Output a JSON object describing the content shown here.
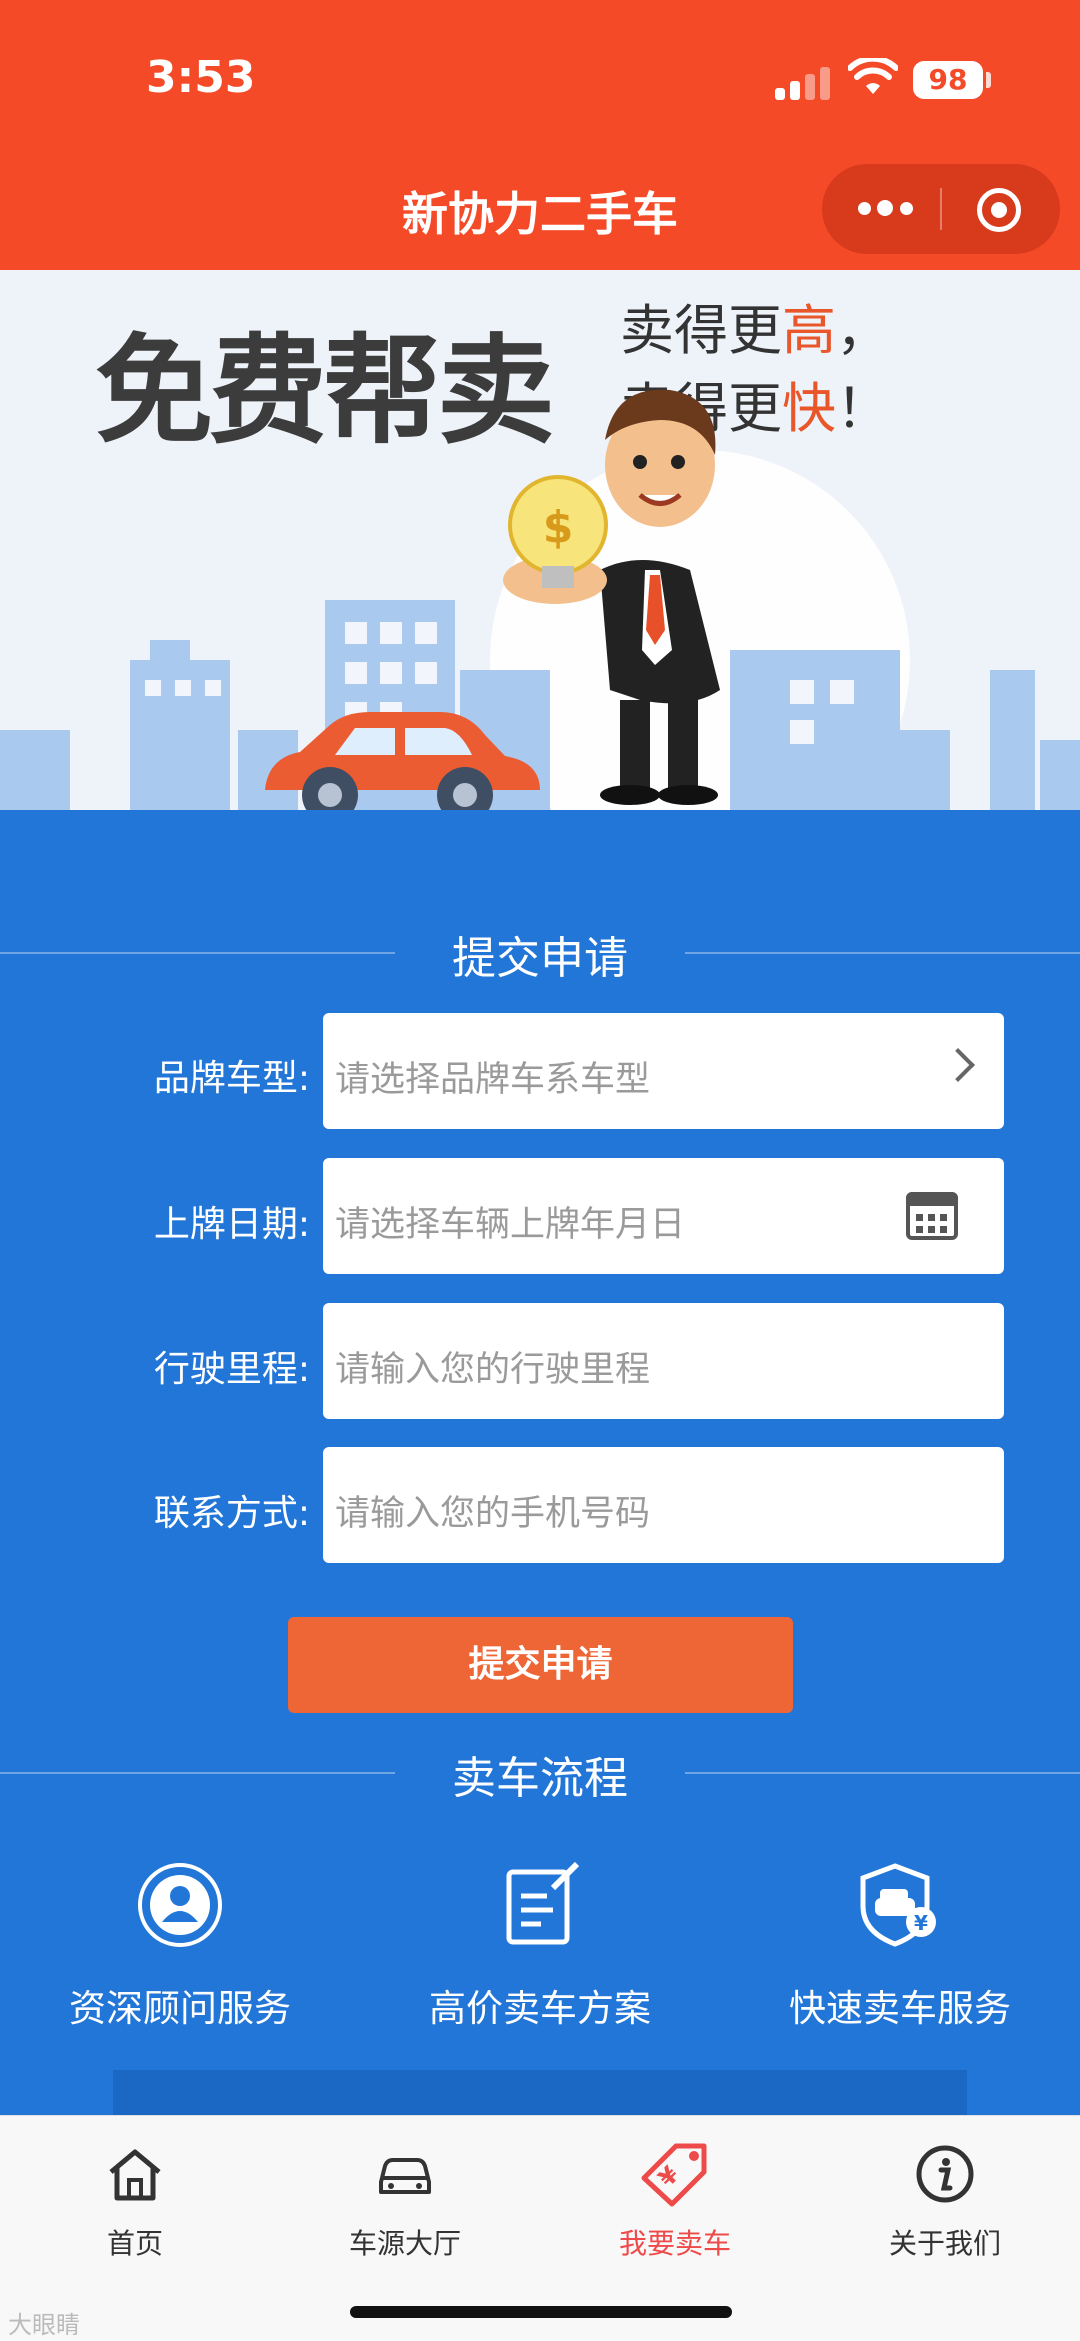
{
  "status": {
    "time": "3:53",
    "battery": "98"
  },
  "header": {
    "title": "新协力二手车"
  },
  "banner": {
    "headline": "免费帮卖",
    "slogan_line1_prefix": "卖得更",
    "slogan_line1_emph": "高",
    "slogan_line1_suffix": "，",
    "slogan_line2_prefix": "卖得更",
    "slogan_line2_emph": "快",
    "slogan_line2_suffix": "！",
    "sign_symbol": "$"
  },
  "form": {
    "section_title": "提交申请",
    "fields": [
      {
        "label": "品牌车型:",
        "placeholder": "请选择品牌车系车型"
      },
      {
        "label": "上牌日期:",
        "placeholder": "请选择车辆上牌年月日"
      },
      {
        "label": "行驶里程:",
        "placeholder": "请输入您的行驶里程"
      },
      {
        "label": "联系方式:",
        "placeholder": "请输入您的手机号码"
      }
    ],
    "submit_label": "提交申请"
  },
  "process": {
    "section_title": "卖车流程",
    "items": [
      {
        "label": "资深顾问服务",
        "icon": "advisor-icon"
      },
      {
        "label": "高价卖车方案",
        "icon": "edit-plan-icon"
      },
      {
        "label": "快速卖车服务",
        "icon": "car-shield-icon"
      }
    ]
  },
  "tabbar": {
    "items": [
      {
        "label": "首页",
        "icon": "home-icon"
      },
      {
        "label": "车源大厅",
        "icon": "car-icon"
      },
      {
        "label": "我要卖车",
        "icon": "price-tag-icon",
        "active": true
      },
      {
        "label": "关于我们",
        "icon": "info-icon"
      }
    ]
  },
  "watermark": "大眼睛",
  "colors": {
    "header": "#f44a28",
    "page_bg": "#2276d8",
    "button": "#ee6536",
    "active_tab": "#ee4a4a"
  }
}
